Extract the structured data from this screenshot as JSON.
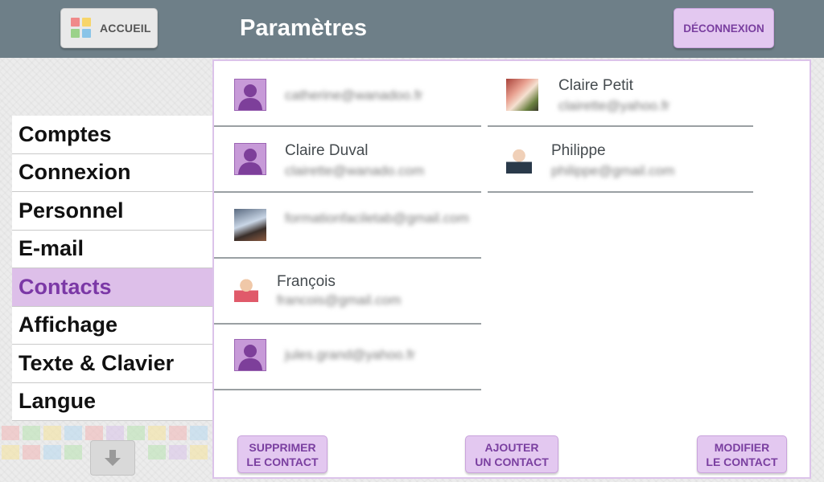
{
  "header": {
    "home_label": "ACCUEIL",
    "title": "Paramètres",
    "logout_label": "DÉCONNEXION"
  },
  "menu": {
    "items": [
      {
        "label": "Comptes",
        "active": false
      },
      {
        "label": "Connexion",
        "active": false
      },
      {
        "label": "Personnel",
        "active": false
      },
      {
        "label": "E-mail",
        "active": false
      },
      {
        "label": "Contacts",
        "active": true
      },
      {
        "label": "Affichage",
        "active": false
      },
      {
        "label": "Texte & Clavier",
        "active": false
      },
      {
        "label": "Langue",
        "active": false
      }
    ],
    "scroll_icon": "arrow-down-icon"
  },
  "contacts": {
    "left_column": [
      {
        "name": "",
        "email": "catherine@wanadoo.fr",
        "avatar": "placeholder"
      },
      {
        "name": "Claire Duval",
        "email": "clairette@wanado.com",
        "avatar": "placeholder"
      },
      {
        "name": "",
        "email": "formationfaciletab@gmail.com",
        "avatar": "photo-room"
      },
      {
        "name": "François",
        "email": "francois@gmail.com",
        "avatar": "photo-man-red"
      },
      {
        "name": "",
        "email": "jules.grand@yahoo.fr",
        "avatar": "placeholder"
      }
    ],
    "right_column": [
      {
        "name": "Claire Petit",
        "email": "clairette@yahoo.fr",
        "avatar": "photo-group"
      },
      {
        "name": "Philippe",
        "email": "philippe@gmail.com",
        "avatar": "photo-man-glasses"
      }
    ]
  },
  "actions": {
    "delete_label": "SUPPRIMER\nLE CONTACT",
    "add_label": "AJOUTER\nUN CONTACT",
    "edit_label": "MODIFIER\nLE CONTACT"
  },
  "colors": {
    "header_bg": "#6e7f88",
    "accent": "#7b38a6",
    "accent_light": "#e3c8f0"
  }
}
